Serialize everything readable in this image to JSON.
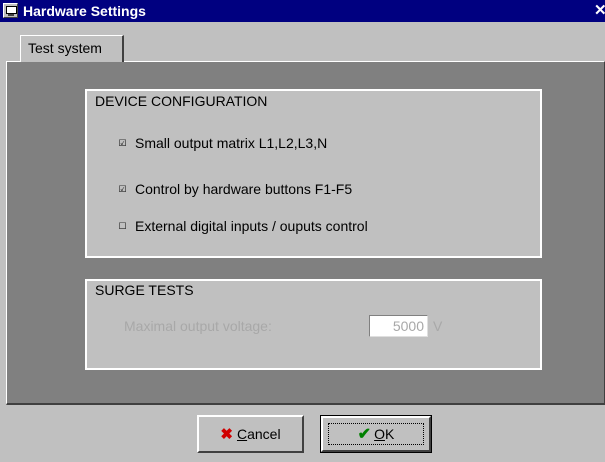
{
  "window": {
    "title": "Hardware Settings",
    "icon": "computer-icon",
    "close_glyph": "✕",
    "colors": {
      "titlebar": "#000080",
      "face": "#c0c0c0",
      "panel": "#808080",
      "disabled_text": "#a8a8a8"
    }
  },
  "tabs": [
    {
      "label": "Test system",
      "active": true
    }
  ],
  "device_config": {
    "title": "DEVICE CONFIGURATION",
    "options": [
      {
        "label": "Small output matrix L1,L2,L3,N",
        "checked": true
      },
      {
        "label": "Control by hardware buttons F1-F5",
        "checked": true
      },
      {
        "label": "External digital inputs / ouputs control",
        "checked": false
      }
    ]
  },
  "surge_tests": {
    "title": "SURGE TESTS",
    "max_voltage_label": "Maximal output voltage:",
    "max_voltage_value": "5000",
    "unit": "V",
    "enabled": false
  },
  "buttons": {
    "cancel": {
      "mnemonic": "C",
      "rest": "ancel",
      "icon": "x-icon"
    },
    "ok": {
      "mnemonic": "O",
      "rest": "K",
      "icon": "checkmark-icon"
    }
  }
}
